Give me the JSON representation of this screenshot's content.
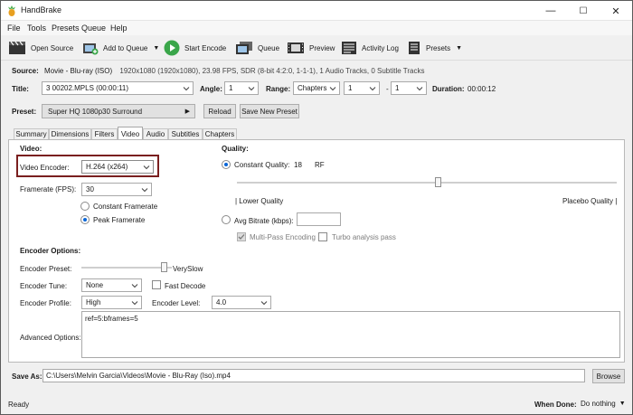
{
  "window": {
    "title": "HandBrake",
    "min": "—",
    "max": "☐",
    "close": "✕"
  },
  "menu": [
    "File",
    "Tools",
    "Presets",
    "Queue",
    "Help"
  ],
  "toolbar": {
    "open_source": "Open Source",
    "add_to_queue": "Add to Queue",
    "start_encode": "Start Encode",
    "queue": "Queue",
    "preview": "Preview",
    "activity_log": "Activity Log",
    "presets": "Presets"
  },
  "source": {
    "label": "Source:",
    "name": "Movie - Blu-ray (ISO)",
    "details": "1920x1080 (1920x1080), 23.98 FPS, SDR (8-bit 4:2:0, 1-1-1), 1 Audio Tracks, 0 Subtitle Tracks"
  },
  "title_row": {
    "title_label": "Title:",
    "title_value": "3  00202.MPLS (00:00:11)",
    "angle_label": "Angle:",
    "angle_value": "1",
    "range_label": "Range:",
    "range_mode": "Chapters",
    "range_start": "1",
    "range_sep": "-",
    "range_end": "1",
    "duration_label": "Duration:",
    "duration_value": "00:00:12"
  },
  "preset_row": {
    "label": "Preset:",
    "value": "Super HQ 1080p30 Surround",
    "reload": "Reload",
    "save_new": "Save New Preset"
  },
  "tabs": [
    "Summary",
    "Dimensions",
    "Filters",
    "Video",
    "Audio",
    "Subtitles",
    "Chapters"
  ],
  "video": {
    "section": "Video:",
    "encoder_label": "Video Encoder:",
    "encoder_value": "H.264 (x264)",
    "framerate_label": "Framerate (FPS):",
    "framerate_value": "30",
    "constant_framerate": "Constant Framerate",
    "peak_framerate": "Peak Framerate"
  },
  "quality": {
    "section": "Quality:",
    "constant_quality": "Constant Quality:",
    "cq_value": "18",
    "rf": "RF",
    "slider_level": 0.53,
    "lower": "| Lower Quality",
    "placebo": "Placebo Quality |",
    "avg_bitrate": "Avg Bitrate (kbps):",
    "multipass": "Multi-Pass Encoding",
    "turbo": "Turbo analysis pass"
  },
  "encoder_options": {
    "section": "Encoder Options:",
    "preset_label": "Encoder Preset:",
    "preset_value": "VerySlow",
    "preset_level": 0.92,
    "tune_label": "Encoder Tune:",
    "tune_value": "None",
    "fast_decode": "Fast Decode",
    "profile_label": "Encoder Profile:",
    "profile_value": "High",
    "level_label": "Encoder Level:",
    "level_value": "4.0",
    "advanced_label": "Advanced Options:",
    "advanced_value": "ref=5:bframes=5"
  },
  "save_as": {
    "label": "Save As:",
    "path": "C:\\Users\\Melvin Garcia\\Videos\\Movie - Blu-Ray (Iso).mp4",
    "browse": "Browse"
  },
  "status": {
    "ready": "Ready",
    "when_done_label": "When Done:",
    "when_done_value": "Do nothing"
  },
  "colors": {
    "highlight_box": "#7a1f1f",
    "accent": "#0a66d8",
    "play_green": "#3aa64a"
  }
}
